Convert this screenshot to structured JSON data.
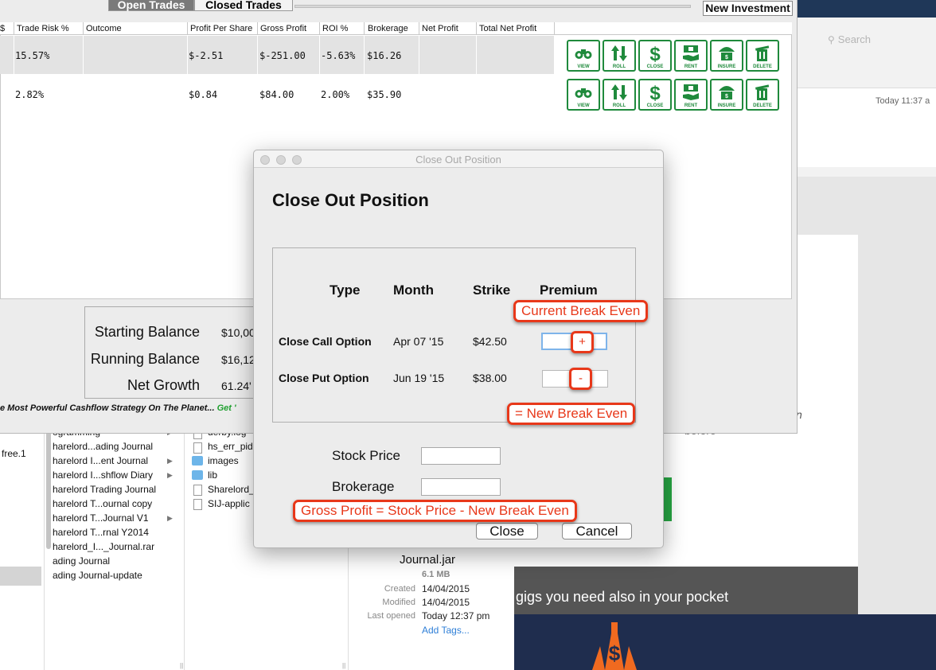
{
  "app": {
    "tabs": [
      {
        "label": "Open Trades",
        "active": true
      },
      {
        "label": "Closed Trades",
        "active": false
      }
    ],
    "new_investment_label": "New Investment",
    "columns": [
      "$",
      "Trade Risk %",
      "Outcome",
      "Profit Per Share",
      "Gross Profit",
      "ROI %",
      "Brokerage",
      "Net Profit",
      "Total Net Profit"
    ],
    "rows": [
      {
        "trade_risk": "15.57%",
        "outcome": "",
        "profit_per_share": "$-2.51",
        "gross_profit": "$-251.00",
        "roi": "-5.63%",
        "brokerage": "$16.26",
        "net_profit": "",
        "total_net_profit": ""
      },
      {
        "trade_risk": "2.82%",
        "outcome": "",
        "profit_per_share": "$0.84",
        "gross_profit": "$84.00",
        "roi": "2.00%",
        "brokerage": "$35.90",
        "net_profit": "",
        "total_net_profit": ""
      }
    ],
    "action_buttons": [
      {
        "label": "VIEW",
        "icon": "binoculars-icon"
      },
      {
        "label": "ROLL",
        "icon": "up-down-arrows-icon"
      },
      {
        "label": "CLOSE",
        "icon": "dollar-icon"
      },
      {
        "label": "RENT",
        "icon": "hand-money-icon"
      },
      {
        "label": "INSURE",
        "icon": "umbrella-icon"
      },
      {
        "label": "DELETE",
        "icon": "trash-icon"
      }
    ],
    "summary": {
      "starting_label": "Starting Balance",
      "starting_value": "$10,00",
      "running_label": "Running Balance",
      "running_value": "$16,12",
      "growth_label": "Net Growth",
      "growth_value": "61.24'"
    },
    "tagline": "e Most Powerful Cashflow Strategy On The Planet...",
    "tagline_link": "Get '",
    "accent_color": "#1f8a3c"
  },
  "dialog": {
    "window_title": "Close Out Position",
    "heading": "Close Out Position",
    "headers": {
      "type": "Type",
      "month": "Month",
      "strike": "Strike",
      "premium": "Premium"
    },
    "rows": [
      {
        "label": "Close Call Option",
        "month": "Apr 07 '15",
        "strike": "$42.50",
        "premium": ""
      },
      {
        "label": "Close Put Option",
        "month": "Jun 19 '15",
        "strike": "$38.00",
        "premium": ""
      }
    ],
    "stock_price_label": "Stock Price",
    "stock_price_value": "",
    "brokerage_label": "Brokerage",
    "brokerage_value": "",
    "close_button": "Close",
    "cancel_button": "Cancel"
  },
  "annotations": {
    "current_break_even": "Current Break Even",
    "plus": "+",
    "minus": "-",
    "new_break_even": "= New Break Even",
    "gross_profit_formula": "Gross Profit = Stock Price - New Break Even",
    "color": "#e8381a"
  },
  "finder": {
    "col1_item": "free.1",
    "col2_items": [
      {
        "label": "ogramming",
        "arrow": true
      },
      {
        "label": "harelord...ading Journal",
        "arrow": false
      },
      {
        "label": "harelord I...ent Journal",
        "arrow": true
      },
      {
        "label": "harelord I...shflow Diary",
        "arrow": true
      },
      {
        "label": "harelord Trading Journal",
        "arrow": false
      },
      {
        "label": "harelord T...ournal copy",
        "arrow": false
      },
      {
        "label": "harelord T...Journal V1",
        "arrow": true
      },
      {
        "label": "harelord T...rnal Y2014",
        "arrow": false
      },
      {
        "label": "harelord_I..._Journal.rar",
        "arrow": false
      },
      {
        "label": "ading Journal",
        "arrow": false
      },
      {
        "label": "ading Journal-update",
        "arrow": false
      }
    ],
    "col3_items": [
      {
        "label": "derby.log",
        "icon": "doc"
      },
      {
        "label": "hs_err_pid",
        "icon": "doc"
      },
      {
        "label": "images",
        "icon": "folder"
      },
      {
        "label": "lib",
        "icon": "folder"
      },
      {
        "label": "Sharelord_",
        "icon": "doc"
      },
      {
        "label": "SIJ-applic",
        "icon": "doc"
      }
    ],
    "preview": {
      "name": "Journal.jar",
      "size": "6.1 MB",
      "created_label": "Created",
      "created": "14/04/2015",
      "modified_label": "Modified",
      "modified": "14/04/2015",
      "last_opened_label": "Last opened",
      "last_opened": "Today 12:37 pm",
      "add_tags": "Add Tags..."
    }
  },
  "background": {
    "search_placeholder": "Search",
    "mail_time": "Today 11:37 a",
    "web_text_italic": "n",
    "web_text_before": "before",
    "band_text": "gigs you need also in your pocket"
  }
}
